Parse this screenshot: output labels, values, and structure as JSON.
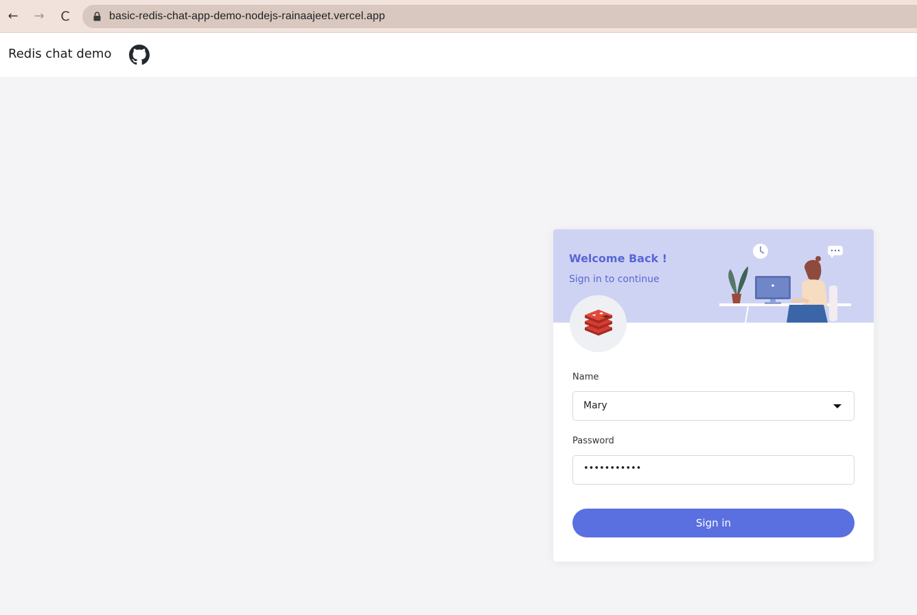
{
  "browser": {
    "back_icon": "←",
    "forward_icon": "→",
    "reload_icon": "C",
    "url": "basic-redis-chat-app-demo-nodejs-rainaajeet.vercel.app"
  },
  "header": {
    "title": "Redis chat demo",
    "github_icon": "github-icon"
  },
  "login": {
    "welcome_title": "Welcome Back !",
    "welcome_subtitle": "Sign in to continue",
    "name_label": "Name",
    "name_value": "Mary",
    "password_label": "Password",
    "password_value": "•••••••••••",
    "signin_label": "Sign in"
  },
  "colors": {
    "accent": "#5a6fe0",
    "hero_bg": "#cfd3f3",
    "heading": "#5766d6",
    "browser_bar": "#f2e2dc"
  }
}
